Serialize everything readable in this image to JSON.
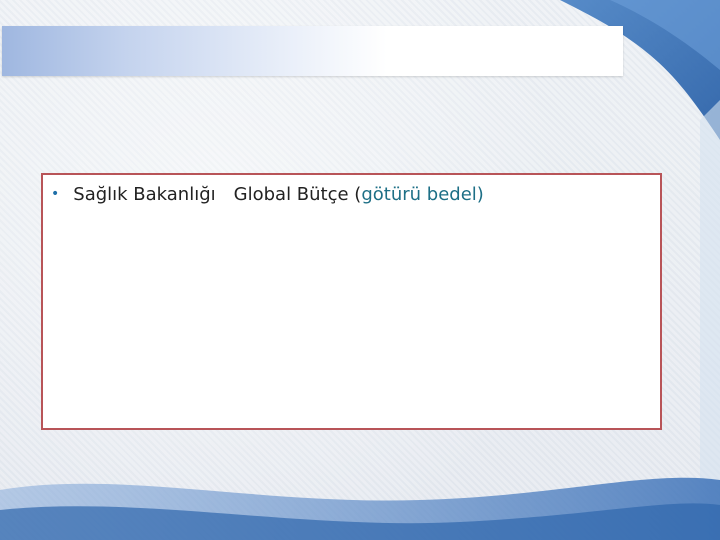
{
  "slide": {
    "bullet": {
      "marker": "•",
      "part1": "Sağlık Bakanlığı",
      "part2": "Global Bütçe (",
      "part3": "götürü bedel)"
    }
  }
}
